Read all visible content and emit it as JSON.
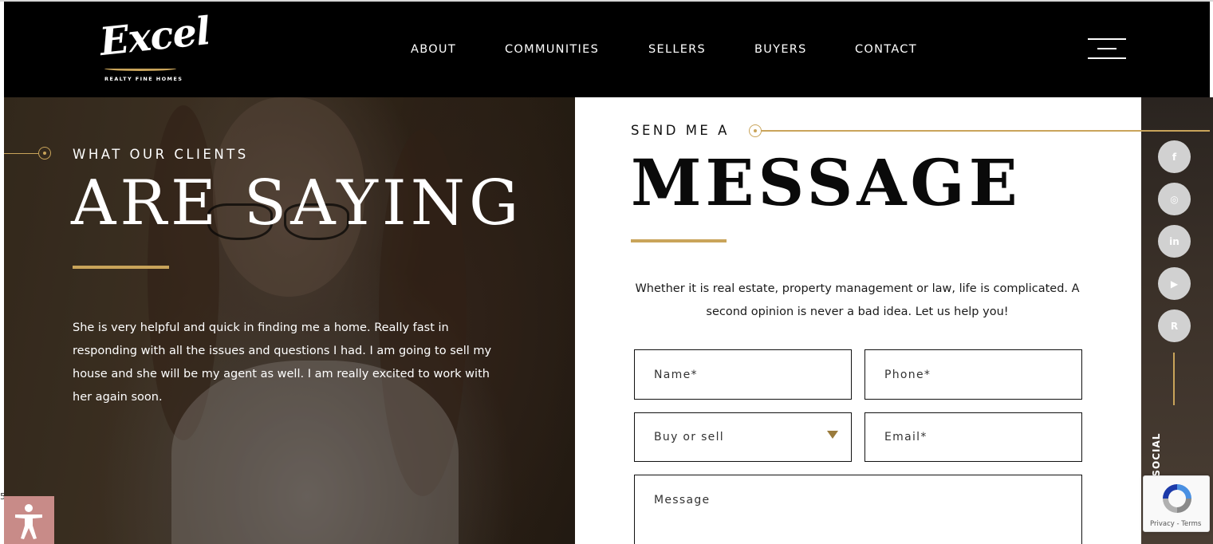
{
  "brand": {
    "name": "Excel",
    "tagline": "REALTY FINE HOMES"
  },
  "nav": {
    "items": [
      "ABOUT",
      "COMMUNITIES",
      "SELLERS",
      "BUYERS",
      "CONTACT"
    ]
  },
  "testimonial": {
    "kicker": "WHAT OUR CLIENTS",
    "title": "ARE SAYING",
    "quote": "She is very helpful and quick in finding me a home. Really fast in responding with all the issues and questions I had. I am going to sell my house and she will be my agent as well. I am really excited to work with her again soon."
  },
  "contact_form": {
    "kicker": "SEND ME A",
    "title": "MESSAGE",
    "intro": "Whether it is real estate, property management or law, life is complicated. A second opinion is never a bad idea. Let us help you!",
    "fields": {
      "name": "Name*",
      "phone": "Phone*",
      "buy_sell": "Buy or sell",
      "email": "Email*",
      "message": "Message"
    }
  },
  "social": {
    "icons": [
      "facebook-icon",
      "instagram-icon",
      "linkedin-icon",
      "youtube-icon",
      "realtor-icon"
    ],
    "glyphs": [
      "f",
      "◎",
      "in",
      "▶",
      "R"
    ],
    "label": "T SOCIAL"
  },
  "recaptcha": {
    "links": "Privacy - Terms"
  },
  "side_number": "5",
  "colors": {
    "accent": "#c9a45a",
    "header_bg": "#000000",
    "accessibility_bg": "#c88b88"
  }
}
